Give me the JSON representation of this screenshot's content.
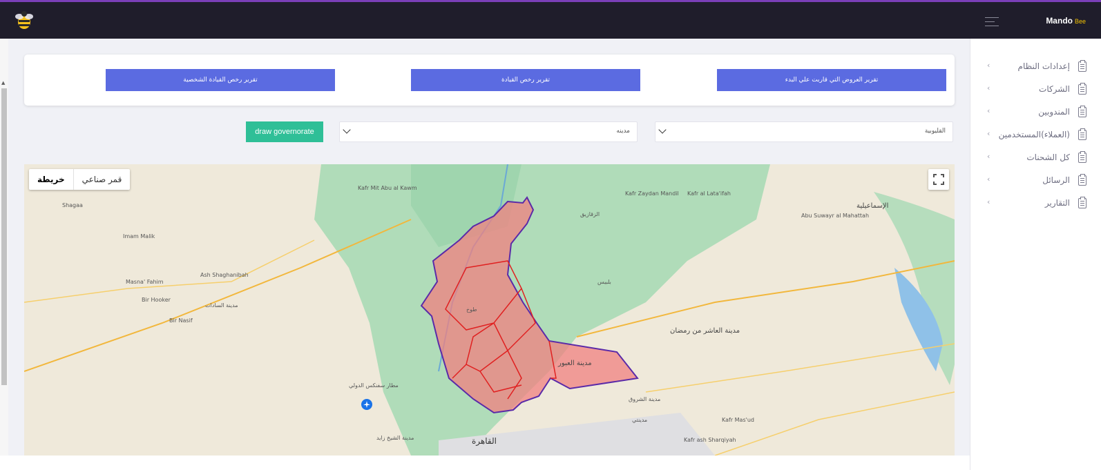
{
  "header": {
    "brand_name": "Mando",
    "brand_accent": "Bee",
    "logo_icon": "bee-icon",
    "menu_icon": "hamburger-icon"
  },
  "sidebar": {
    "items": [
      {
        "label": "إعدادات النظام",
        "icon": "clipboard-icon"
      },
      {
        "label": "الشركات",
        "icon": "clipboard-icon"
      },
      {
        "label": "المندوبين",
        "icon": "clipboard-icon"
      },
      {
        "label": "(العملاء)المستخدمين",
        "icon": "clipboard-icon"
      },
      {
        "label": "كل الشحنات",
        "icon": "clipboard-icon"
      },
      {
        "label": "الرسائل",
        "icon": "clipboard-icon"
      },
      {
        "label": "التقارير",
        "icon": "clipboard-icon"
      }
    ],
    "chevron": "‹"
  },
  "reports": {
    "btn_offers": "تقرير العروض التي قاربت علي البدء",
    "btn_licenses": "تقرير رخص القيادة",
    "btn_personal": "تقرير رخص القيادة الشخصية"
  },
  "filters": {
    "governorate_selected": "القليوبية",
    "city_selected": "مدينه",
    "draw_button": "draw governorate"
  },
  "map": {
    "type_map": "خريطة",
    "type_satellite": "قمر صناعي",
    "labels": {
      "ismailia": "الإسماعيلية",
      "tenth_ramadan": "مدينة العاشر من رمضان",
      "obour": "مدينة العبور",
      "cairo": "القاهرة",
      "shorouk": "مدينة الشروق",
      "new_cairo": "مدينتي",
      "sphinx_airport": "مطار سفنكس الدولي",
      "sheikh_zayed": "مدينة الشيخ زايد",
      "sadat": "مدينة السادات",
      "tukh": "طوخ",
      "belbeis": "بلبيس",
      "zagazig": "الزقازيق",
      "shagaa": "Shagaa",
      "imam_malik": "Imam Malik",
      "masna_fahim": "Masna' Fahim",
      "bir_hooker": "Bir Hooker",
      "bir_nasif": "Bir Nasif",
      "ash_shaghanibah": "Ash Shaghanibah",
      "kafr_mit_abu": "Kafr Mit Abu al Kawm",
      "kafr_zaydan": "Kafr Zaydan Mandil",
      "kafr_al_lataifah": "Kafr al Lata'ifah",
      "abu_suwayr": "Abu Suwayr al Mahattah",
      "kafr_masud": "Kafr Mas'ud",
      "kafr_ash": "Kafr ash Sharqiyah"
    }
  },
  "colors": {
    "topbar": "#1f1d2b",
    "accent_purple": "#7b3fb8",
    "report_button": "#5b6be1",
    "draw_button": "#2fbf97",
    "polygon_fill": "#f08080",
    "polygon_stroke": "#e02020",
    "polygon_outline": "#5a2aa8"
  }
}
